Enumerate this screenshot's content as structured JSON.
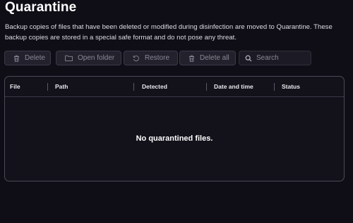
{
  "page": {
    "title": "Quarantine",
    "description": "Backup copies of files that have been deleted or modified during disinfection are moved to Quarantine. These backup copies are stored in a special safe format and do not pose any threat."
  },
  "toolbar": {
    "delete_label": "Delete",
    "open_folder_label": "Open folder",
    "restore_label": "Restore",
    "delete_all_label": "Delete all",
    "search_placeholder": "Search"
  },
  "table": {
    "columns": [
      "File",
      "Path",
      "Detected",
      "Date and time",
      "Status"
    ],
    "empty_message": "No quarantined files."
  },
  "colors": {
    "background": "#0f0e16",
    "button_bg": "#22212c",
    "disabled_text": "#8a8996",
    "border": "#4a4957"
  },
  "icons": {
    "delete": "trash-icon",
    "open_folder": "folder-icon",
    "restore": "restore-icon",
    "delete_all": "trash-icon",
    "search": "search-icon"
  }
}
